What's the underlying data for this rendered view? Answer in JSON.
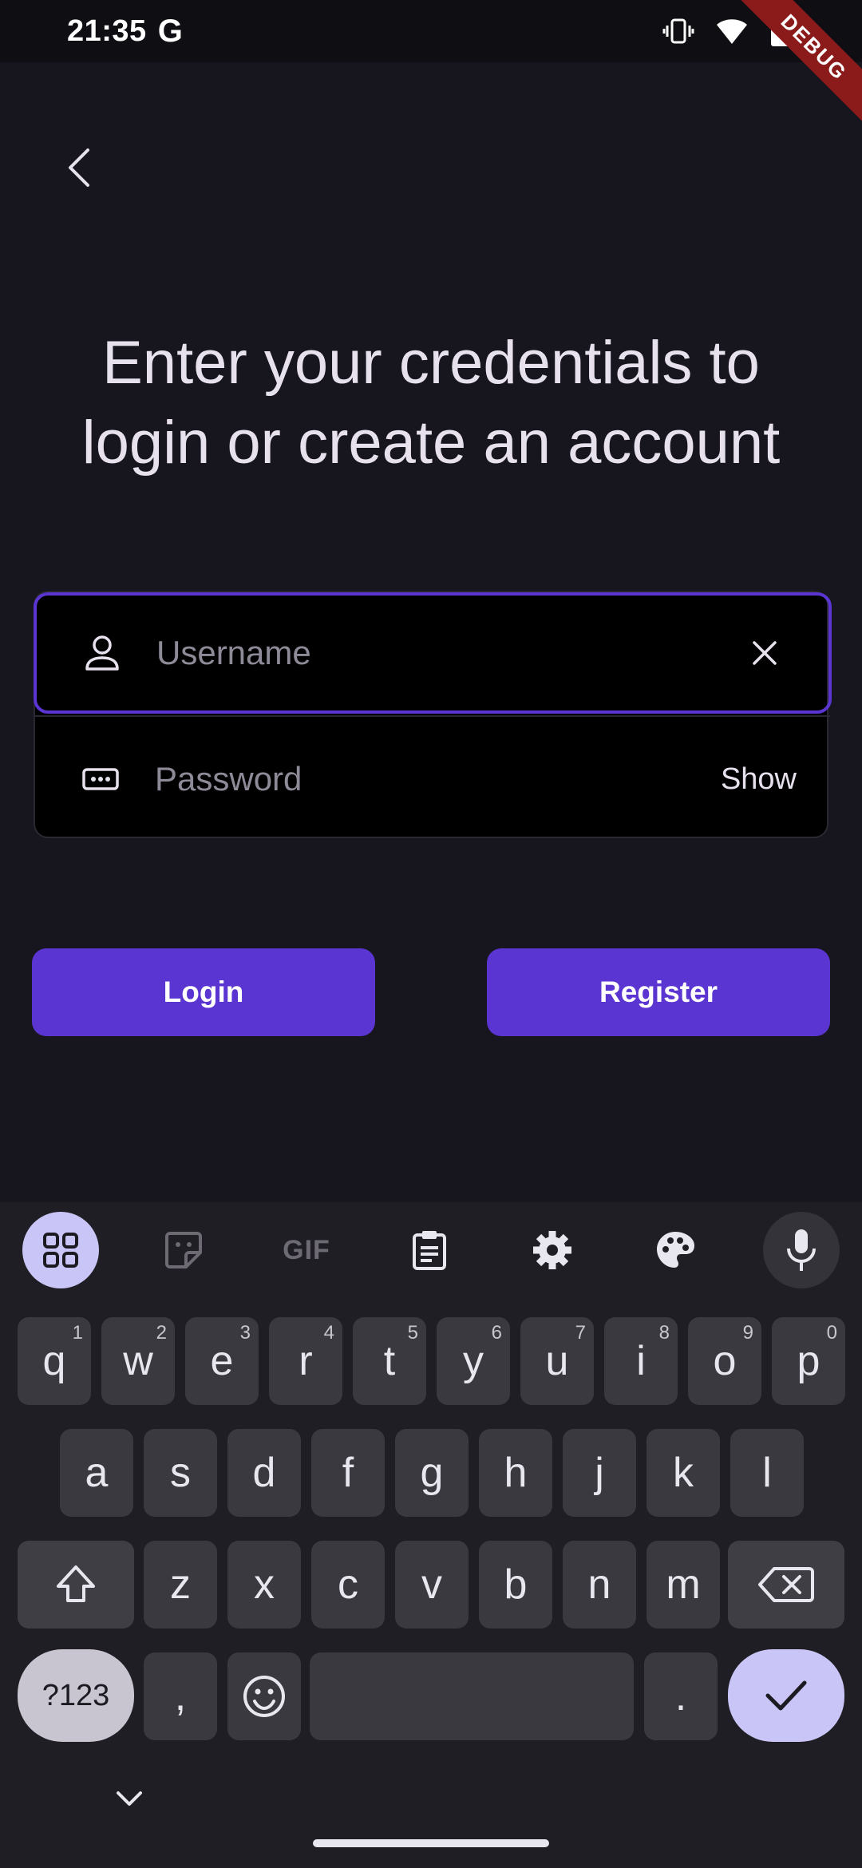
{
  "status_bar": {
    "time": "21:35",
    "g_logo": "G",
    "debug_ribbon": "DEBUG"
  },
  "login": {
    "heading": "Enter your credentials to login or create an account",
    "username": {
      "placeholder": "Username",
      "value": ""
    },
    "password": {
      "placeholder": "Password",
      "value": ""
    },
    "show_label": "Show",
    "login_label": "Login",
    "register_label": "Register"
  },
  "keyboard": {
    "toolbar": [
      "apps-grid-icon",
      "sticker-icon",
      "GIF",
      "clipboard-icon",
      "settings-icon",
      "palette-icon",
      "mic-icon"
    ],
    "gif_label": "GIF",
    "row1": [
      {
        "key": "q",
        "hint": "1"
      },
      {
        "key": "w",
        "hint": "2"
      },
      {
        "key": "e",
        "hint": "3"
      },
      {
        "key": "r",
        "hint": "4"
      },
      {
        "key": "t",
        "hint": "5"
      },
      {
        "key": "y",
        "hint": "6"
      },
      {
        "key": "u",
        "hint": "7"
      },
      {
        "key": "i",
        "hint": "8"
      },
      {
        "key": "o",
        "hint": "9"
      },
      {
        "key": "p",
        "hint": "0"
      }
    ],
    "row2": [
      "a",
      "s",
      "d",
      "f",
      "g",
      "h",
      "j",
      "k",
      "l"
    ],
    "row3": [
      "z",
      "x",
      "c",
      "v",
      "b",
      "n",
      "m"
    ],
    "symbols_label": "?123",
    "comma_label": ",",
    "period_label": "."
  },
  "colors": {
    "accent": "#5b35d2",
    "background": "#17151d",
    "keyboard": "#1f1e24"
  }
}
